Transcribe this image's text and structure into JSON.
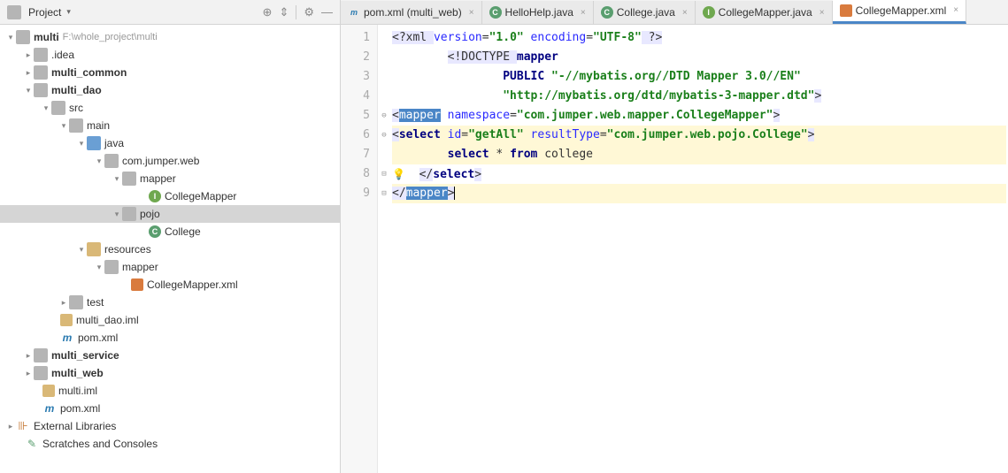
{
  "panel": {
    "title": "Project",
    "icons": {
      "target": "⊕",
      "collapse": "⇕",
      "settings": "⚙",
      "hide": "—"
    }
  },
  "tree": {
    "root_name": "multi",
    "root_path": "F:\\whole_project\\multi",
    "items": [
      ".idea",
      "multi_common",
      "multi_dao",
      "src",
      "main",
      "java",
      "com.jumper.web",
      "mapper",
      "CollegeMapper",
      "pojo",
      "College",
      "resources",
      "mapper",
      "CollegeMapper.xml",
      "test",
      "multi_dao.iml",
      "pom.xml",
      "multi_service",
      "multi_web",
      "multi.iml",
      "pom.xml",
      "External Libraries",
      "Scratches and Consoles"
    ]
  },
  "tabs": [
    {
      "label": "pom.xml (multi_web)",
      "icon": "m"
    },
    {
      "label": "HelloHelp.java",
      "icon": "c"
    },
    {
      "label": "College.java",
      "icon": "c"
    },
    {
      "label": "CollegeMapper.java",
      "icon": "i"
    },
    {
      "label": "CollegeMapper.xml",
      "icon": "xml",
      "active": true
    }
  ],
  "editor": {
    "lines": [
      "1",
      "2",
      "3",
      "4",
      "5",
      "6",
      "7",
      "8",
      "9"
    ],
    "l1": {
      "a": "<?xml ",
      "b": "version",
      "c": "=",
      "d": "\"1.0\"",
      "e": " encoding",
      "f": "=",
      "g": "\"UTF-8\"",
      "h": " ?>"
    },
    "l2": {
      "a": "<!DOCTYPE ",
      "b": "mapper"
    },
    "l3": {
      "a": "PUBLIC ",
      "b": "\"-//mybatis.org//DTD Mapper 3.0//EN\""
    },
    "l4": {
      "a": "\"http://mybatis.org/dtd/mybatis-3-mapper.dtd\"",
      "b": ">"
    },
    "l5": {
      "a": "<",
      "b": "mapper",
      "c": " namespace",
      "d": "=",
      "e": "\"com.jumper.web.mapper.CollegeMapper\"",
      "f": ">"
    },
    "l6": {
      "a": "<",
      "b": "select",
      "c": " id",
      "d": "=",
      "e": "\"getAll\"",
      "f": " resultType",
      "g": "=",
      "h": "\"com.jumper.web.pojo.College\"",
      "i": ">"
    },
    "l7": {
      "a": "select",
      "b": " * ",
      "c": "from",
      "d": " college"
    },
    "l8": {
      "a": "</",
      "b": "select",
      "c": ">"
    },
    "l9": {
      "a": "</",
      "b": "mapper",
      "c": ">"
    }
  }
}
